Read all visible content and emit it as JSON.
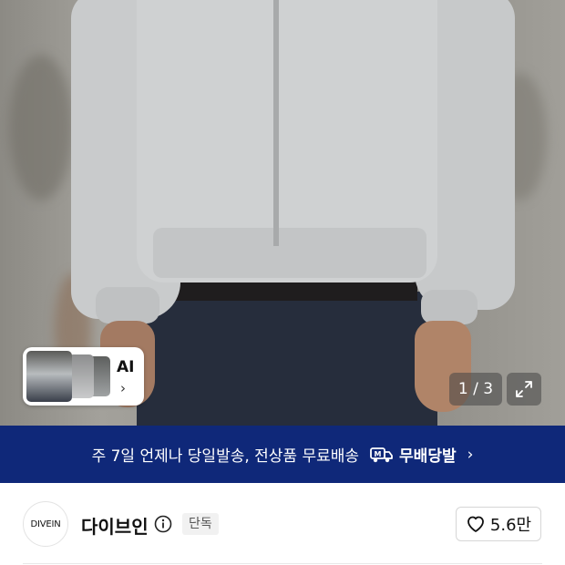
{
  "gallery": {
    "ai_label": "AI",
    "ai_chevron": "›",
    "counter": "1 / 3",
    "expand_icon": "expand-icon"
  },
  "banner": {
    "text": "주 7일 언제나 당일발송, 전상품 무료배송",
    "brand": "무배당발",
    "chevron": "›",
    "background": "#0f2879"
  },
  "store": {
    "logo_text": "DIVEIN",
    "name": "다이브인",
    "badge": "단독",
    "likes": "5.6만"
  }
}
